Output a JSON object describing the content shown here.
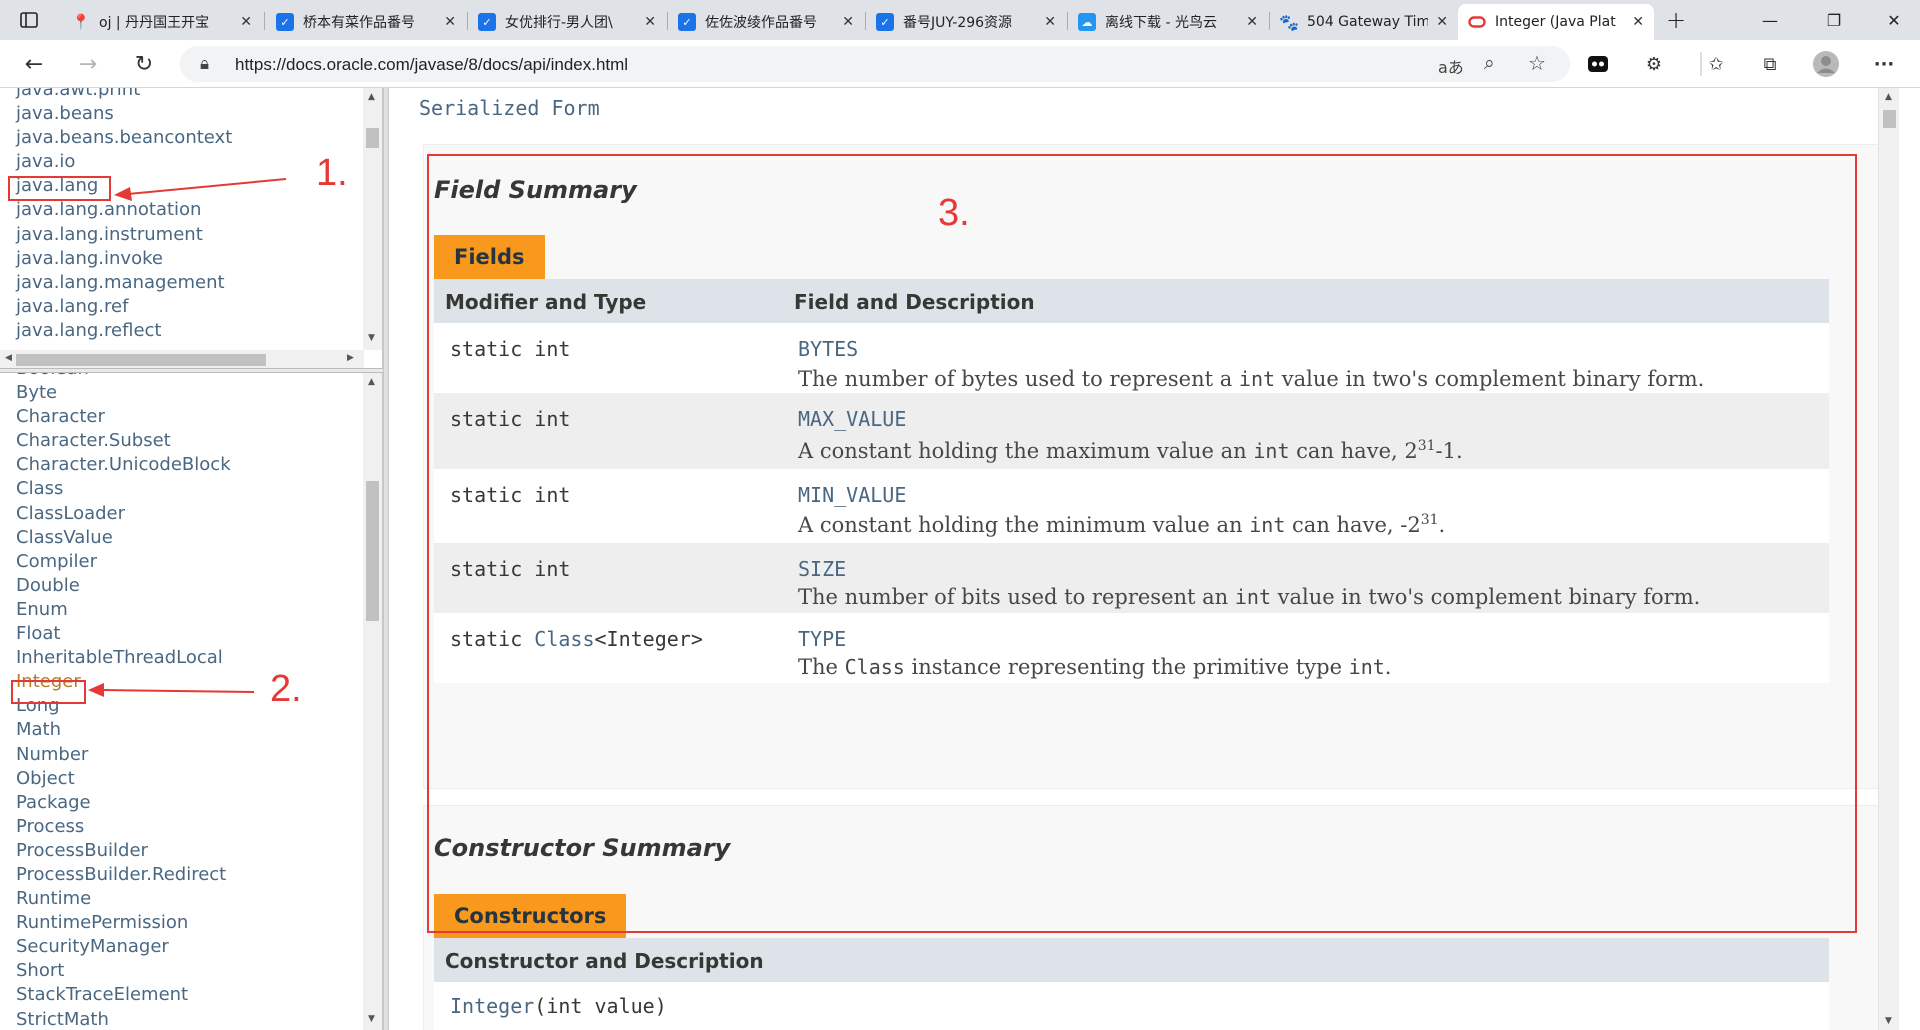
{
  "browser": {
    "tabs": [
      {
        "title": "oj | 丹丹国王开宝",
        "icon": "pin-icon"
      },
      {
        "title": "桥本有菜作品番号",
        "icon": "bookmark-icon"
      },
      {
        "title": "女优排行-男人团\\",
        "icon": "bookmark-icon"
      },
      {
        "title": "佐佐波绫作品番号",
        "icon": "bookmark-icon"
      },
      {
        "title": "番号JUY-296资源",
        "icon": "bookmark-icon"
      },
      {
        "title": "离线下载 - 光鸟云",
        "icon": "cloud-icon"
      },
      {
        "title": "504 Gateway Tim",
        "icon": "paw-icon"
      },
      {
        "title": "Integer (Java Plat",
        "icon": "oracle-icon"
      }
    ],
    "new_tab": "+",
    "url": "https://docs.oracle.com/javase/8/docs/api/index.html"
  },
  "packages": [
    "java.awt.print",
    "java.beans",
    "java.beans.beancontext",
    "java.io",
    "java.lang",
    "java.lang.annotation",
    "java.lang.instrument",
    "java.lang.invoke",
    "java.lang.management",
    "java.lang.ref",
    "java.lang.reflect"
  ],
  "classes": [
    "Boolean",
    "Byte",
    "Character",
    "Character.Subset",
    "Character.UnicodeBlock",
    "Class",
    "ClassLoader",
    "ClassValue",
    "Compiler",
    "Double",
    "Enum",
    "Float",
    "InheritableThreadLocal",
    "Integer",
    "Long",
    "Math",
    "Number",
    "Object",
    "Package",
    "Process",
    "ProcessBuilder",
    "ProcessBuilder.Redirect",
    "Runtime",
    "RuntimePermission",
    "SecurityManager",
    "Short",
    "StackTraceElement",
    "StrictMath"
  ],
  "selected_class": "Integer",
  "main": {
    "serialized_form": "Serialized Form",
    "field_summary": {
      "heading": "Field Summary",
      "caption": "Fields",
      "col1": "Modifier and Type",
      "col2": "Field and Description",
      "rows": [
        {
          "mod": "static int",
          "name": "BYTES",
          "desc_a": "The number of bytes used to represent a ",
          "code": "int",
          "desc_b": " value in two's complement binary form."
        },
        {
          "mod": "static int",
          "name": "MAX_VALUE",
          "desc_a": "A constant holding the maximum value an ",
          "code": "int",
          "desc_b": " can have, 2",
          "sup": "31",
          "desc_c": "-1."
        },
        {
          "mod": "static int",
          "name": "MIN_VALUE",
          "desc_a": "A constant holding the minimum value an ",
          "code": "int",
          "desc_b": " can have, -2",
          "sup": "31",
          "desc_c": "."
        },
        {
          "mod": "static int",
          "name": "SIZE",
          "desc_a": "The number of bits used to represent an ",
          "code": "int",
          "desc_b": " value in two's complement binary form."
        },
        {
          "mod_a": "static ",
          "mod_link": "Class",
          "mod_b": "<Integer>",
          "name": "TYPE",
          "desc_a": "The ",
          "code": "Class",
          "desc_b": " instance representing the primitive type ",
          "code2": "int",
          "desc_c": "."
        }
      ]
    },
    "constructor_summary": {
      "heading": "Constructor Summary",
      "caption": "Constructors",
      "col1": "Constructor and Description",
      "first_name": "Integer",
      "first_args": "(int value)"
    }
  },
  "annotations": {
    "a1": "1.",
    "a2": "2.",
    "a3": "3.",
    "color": "#e53935"
  }
}
